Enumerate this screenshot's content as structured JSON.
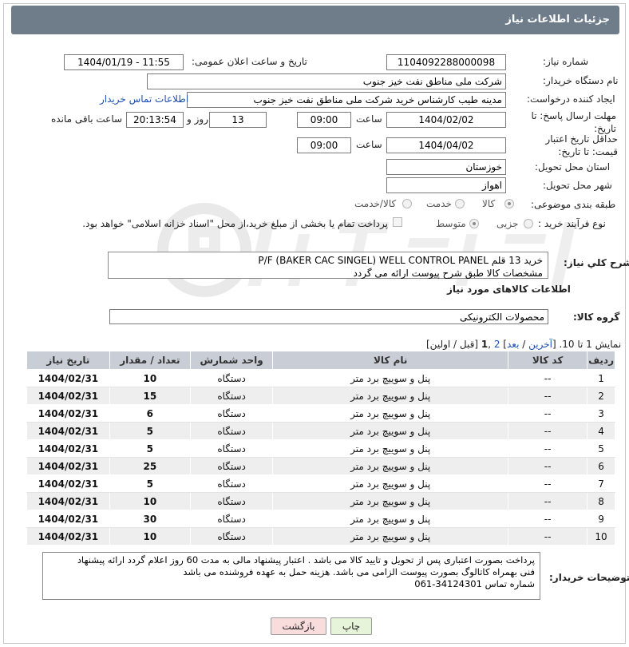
{
  "title": "جزئیات اطلاعات نیاز",
  "fields": {
    "need_number_label": "شماره نیاز:",
    "need_number": "1104092288000098",
    "announce_label": "تاریخ و ساعت اعلان عمومی:",
    "announce_value": "1404/01/19 - 11:55",
    "buyer_org_label": "نام دستگاه خریدار:",
    "buyer_org": "شرکت ملی مناطق نفت خیز جنوب",
    "creator_label": "ایجاد کننده درخواست:",
    "creator": "مدینه طیب کارشناس خرید شرکت ملی مناطق نفت خیز جنوب",
    "contact_link": "اطلاعات تماس خریدار",
    "reply_deadline_label": "مهلت ارسال پاسخ: تا تاریخ:",
    "reply_date": "1404/02/02",
    "time_label": "ساعت",
    "reply_time": "09:00",
    "days_value": "13",
    "days_label": "روز و",
    "remaining_time": "20:13:54",
    "remaining_label": "ساعت باقی مانده",
    "price_validity_label": "حداقل تاریخ اعتبار قیمت: تا تاریخ:",
    "validity_date": "1404/04/02",
    "validity_time": "09:00",
    "province_label": "استان محل تحویل:",
    "province": "خوزستان",
    "city_label": "شهر محل تحویل:",
    "city": "اهواز",
    "category_label": "طبقه بندی موضوعی:",
    "category_goods": "کالا",
    "category_service": "خدمت",
    "category_both": "کالا/خدمت",
    "process_label": "نوع فرآیند خرید :",
    "process_partial": "جزیی",
    "process_medium": "متوسط",
    "treasury_note": "پرداخت تمام یا بخشی از مبلغ خرید،از محل \"اسناد خزانه اسلامی\" خواهد بود.",
    "summary_label": "شرح کلي نياز:",
    "summary_line1": "خرید 13 قلم P/F (BAKER CAC SINGEL) WELL CONTROL PANEL",
    "summary_line2": "مشخصات کالا طبق شرح پیوست ارائه می گردد",
    "goods_section": "اطلاعات کالاهای مورد نیاز",
    "goods_group_label": "گروه کالا:",
    "goods_group": "محصولات الکترونیکی"
  },
  "pagination": {
    "prefix": "نمایش 1 تا 10. [",
    "last": "آخرین",
    "sep1": " / ",
    "next": "بعد",
    "sep2": "] ",
    "page2": "2",
    "comma": " ,",
    "page1": "1",
    "suffix": " [قبل / اولین]"
  },
  "table": {
    "headers": [
      "ردیف",
      "کد کالا",
      "نام کالا",
      "واحد شمارش",
      "تعداد / مقدار",
      "تاریخ نیاز"
    ],
    "rows": [
      [
        "1",
        "--",
        "پنل و سوییچ برد متر",
        "دستگاه",
        "10",
        "1404/02/31"
      ],
      [
        "2",
        "--",
        "پنل و سوییچ برد متر",
        "دستگاه",
        "15",
        "1404/02/31"
      ],
      [
        "3",
        "--",
        "پنل و سوییچ برد متر",
        "دستگاه",
        "6",
        "1404/02/31"
      ],
      [
        "4",
        "--",
        "پنل و سوییچ برد متر",
        "دستگاه",
        "5",
        "1404/02/31"
      ],
      [
        "5",
        "--",
        "پنل و سوییچ برد متر",
        "دستگاه",
        "5",
        "1404/02/31"
      ],
      [
        "6",
        "--",
        "پنل و سوییچ برد متر",
        "دستگاه",
        "25",
        "1404/02/31"
      ],
      [
        "7",
        "--",
        "پنل و سوییچ برد متر",
        "دستگاه",
        "5",
        "1404/02/31"
      ],
      [
        "8",
        "--",
        "پنل و سوییچ برد متر",
        "دستگاه",
        "10",
        "1404/02/31"
      ],
      [
        "9",
        "--",
        "پنل و سوییچ برد متر",
        "دستگاه",
        "30",
        "1404/02/31"
      ],
      [
        "10",
        "--",
        "پنل و سوییچ برد متر",
        "دستگاه",
        "10",
        "1404/02/31"
      ]
    ]
  },
  "buyer_notes": {
    "label": "توضیحات خریدار:",
    "line1": "پرداخت بصورت اعتباری پس از تحویل و تایید کالا می باشد . اعتبار پیشنهاد مالی به مدت 60 روز اعلام گردد  ارائه پیشنهاد",
    "line2": "فنی بهمراه کاتالوگ بصورت پیوست الزامی می باشد. هزینه حمل به عهده فروشنده می باشد",
    "line3": "شماره تماس 34124301-061"
  },
  "buttons": {
    "print": "چاپ",
    "back": "بازگشت"
  },
  "colors": {
    "title_bg": "#6f7d8b",
    "header_bg": "#c9ced6",
    "link": "#1b4fb5",
    "print_bg": "#e6f4d9",
    "back_bg": "#f9dcdc"
  }
}
